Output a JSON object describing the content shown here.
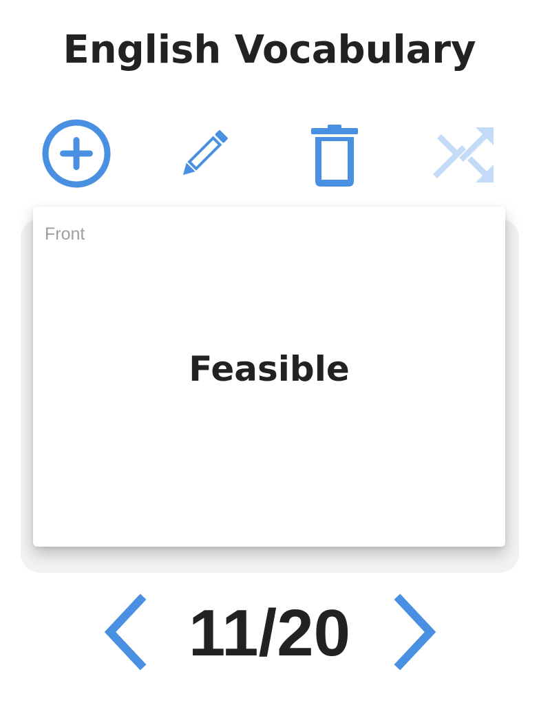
{
  "header": {
    "title": "English Vocabulary"
  },
  "toolbar": {
    "buttons": [
      {
        "icon": "plus-circle-icon",
        "state": "enabled"
      },
      {
        "icon": "pencil-icon",
        "state": "enabled"
      },
      {
        "icon": "trash-icon",
        "state": "enabled"
      },
      {
        "icon": "shuffle-icon",
        "state": "disabled"
      }
    ]
  },
  "card": {
    "side_label": "Front",
    "word": "Feasible"
  },
  "pager": {
    "counter": "11/20",
    "current": 11,
    "total": 20,
    "prev_icon": "chevron-left-icon",
    "next_icon": "chevron-right-icon"
  },
  "colors": {
    "accent": "#4a90e2",
    "accent_disabled": "#c3dbf7",
    "text": "#222222",
    "muted_text": "#9e9e9e"
  }
}
